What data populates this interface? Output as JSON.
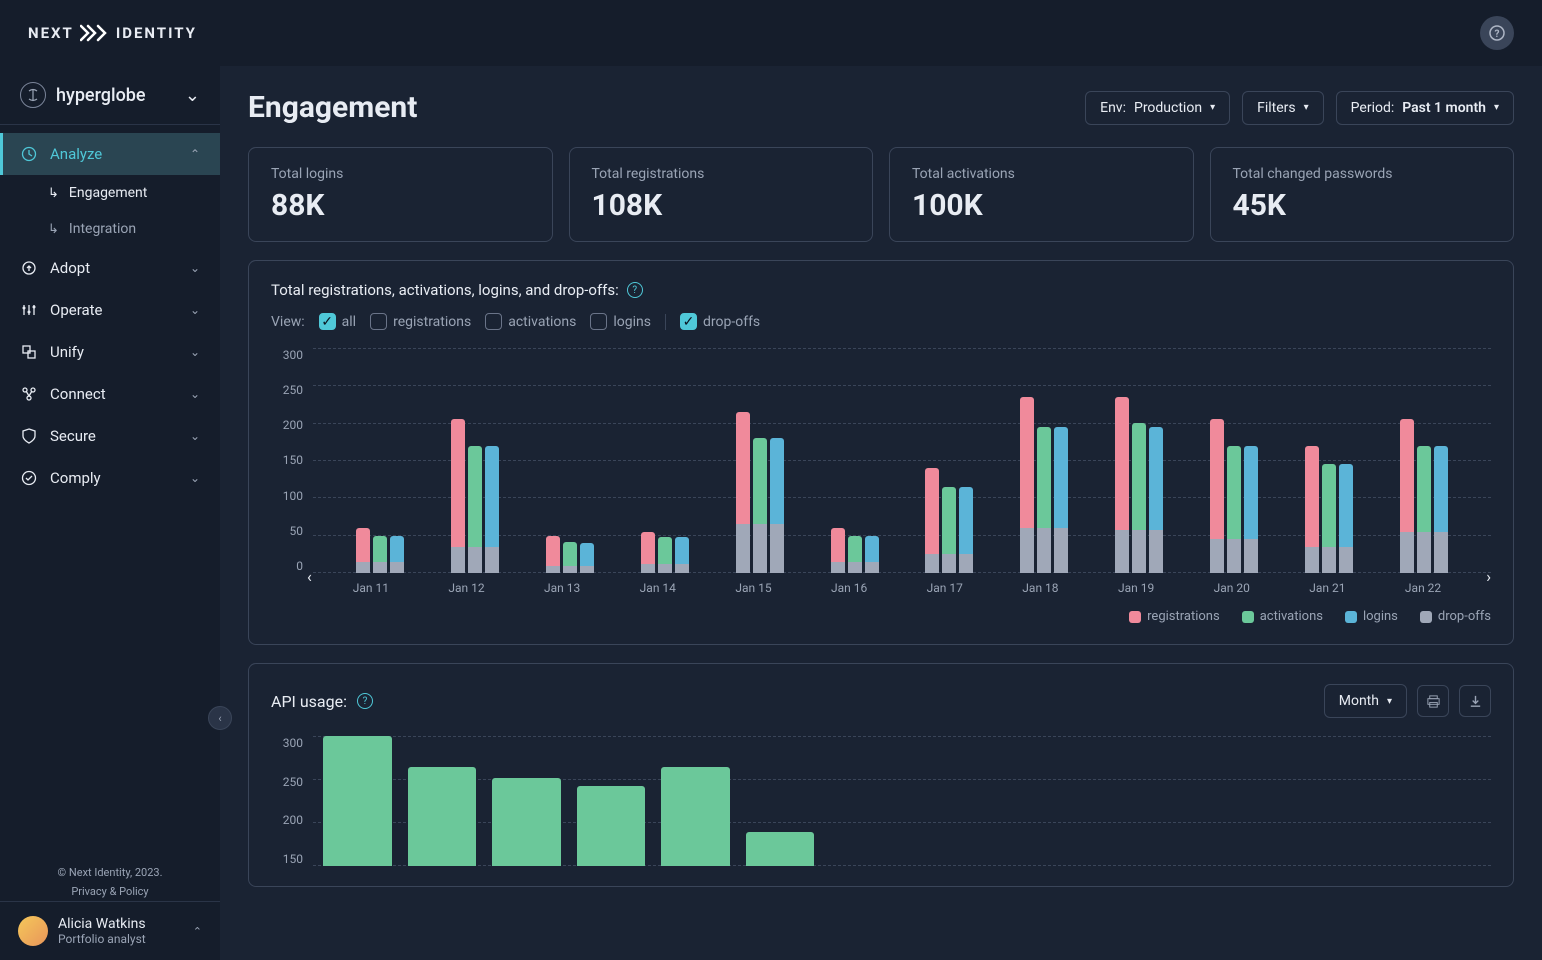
{
  "brand": {
    "left": "NEXT",
    "right": "IDENTITY"
  },
  "org": {
    "name": "hyperglobe"
  },
  "nav": [
    {
      "label": "Analyze",
      "expanded": true,
      "active": true,
      "children": [
        {
          "label": "Engagement",
          "active": true
        },
        {
          "label": "Integration",
          "active": false
        }
      ]
    },
    {
      "label": "Adopt"
    },
    {
      "label": "Operate"
    },
    {
      "label": "Unify"
    },
    {
      "label": "Connect"
    },
    {
      "label": "Secure"
    },
    {
      "label": "Comply"
    }
  ],
  "footer": {
    "copyright": "© Next Identity, 2023.",
    "privacy": "Privacy & Policy"
  },
  "user": {
    "name": "Alicia Watkins",
    "role": "Portfolio analyst"
  },
  "page": {
    "title": "Engagement",
    "env_label": "Env:",
    "env_value": "Production",
    "filters_label": "Filters",
    "period_label": "Period:",
    "period_value": "Past 1 month"
  },
  "stats": [
    {
      "label": "Total logins",
      "value": "88K"
    },
    {
      "label": "Total registrations",
      "value": "108K"
    },
    {
      "label": "Total activations",
      "value": "100K"
    },
    {
      "label": "Total changed passwords",
      "value": "45K"
    }
  ],
  "reg_chart": {
    "title": "Total registrations, activations, logins, and drop-offs:",
    "view_label": "View:",
    "filters": [
      {
        "label": "all",
        "checked": true
      },
      {
        "label": "registrations",
        "checked": false
      },
      {
        "label": "activations",
        "checked": false
      },
      {
        "label": "logins",
        "checked": false
      },
      {
        "label": "drop-offs",
        "checked": true,
        "sep": true
      }
    ],
    "legend": [
      {
        "label": "registrations",
        "color": "#f08a9b"
      },
      {
        "label": "activations",
        "color": "#6bc89a"
      },
      {
        "label": "logins",
        "color": "#5bb4d8"
      },
      {
        "label": "drop-offs",
        "color": "#a0a8b8"
      }
    ]
  },
  "api_chart": {
    "title": "API usage:",
    "period": "Month"
  },
  "chart_data": [
    {
      "type": "bar",
      "title": "Total registrations, activations, logins, and drop-offs",
      "ylabel": "",
      "ylim": [
        0,
        300
      ],
      "yticks": [
        0,
        50,
        100,
        150,
        200,
        250,
        300
      ],
      "categories": [
        "Jan 11",
        "Jan 12",
        "Jan 13",
        "Jan 14",
        "Jan 15",
        "Jan 16",
        "Jan 17",
        "Jan 18",
        "Jan 19",
        "Jan 20",
        "Jan 21",
        "Jan 22"
      ],
      "series": [
        {
          "name": "registrations",
          "color": "#f08a9b",
          "values": [
            60,
            205,
            50,
            55,
            215,
            60,
            140,
            235,
            235,
            205,
            170,
            205
          ]
        },
        {
          "name": "activations",
          "color": "#6bc89a",
          "values": [
            50,
            170,
            42,
            48,
            180,
            50,
            115,
            195,
            200,
            170,
            145,
            170
          ]
        },
        {
          "name": "logins",
          "color": "#5bb4d8",
          "values": [
            50,
            170,
            40,
            48,
            180,
            50,
            115,
            195,
            195,
            170,
            145,
            170
          ]
        }
      ],
      "dropoff_overlay": {
        "name": "drop-offs",
        "color": "#a0a8b8",
        "note": "grey base segment on each bar",
        "values": [
          15,
          35,
          10,
          12,
          65,
          15,
          25,
          60,
          58,
          45,
          35,
          55
        ]
      }
    },
    {
      "type": "bar",
      "title": "API usage",
      "ylim": [
        0,
        300
      ],
      "yticks": [
        150,
        200,
        250,
        300
      ],
      "categories_visible": 6,
      "series": [
        {
          "name": "api",
          "color": "#6bc89a",
          "values": [
            300,
            260,
            245,
            235,
            260,
            175
          ]
        }
      ]
    }
  ]
}
